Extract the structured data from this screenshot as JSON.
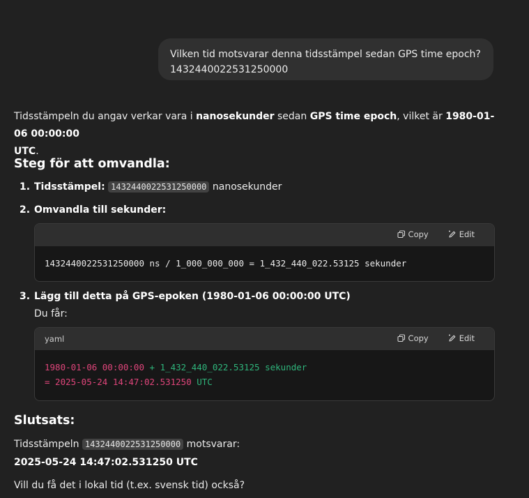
{
  "user_message": {
    "line1": "Vilken tid motsvarar denna tidsstämpel sedan GPS time epoch?",
    "line2": "1432440022531250000"
  },
  "intro": {
    "t1": "Tidsstämpeln du angav verkar vara i ",
    "b1": "nanosekunder",
    "t2": " sedan ",
    "b2": "GPS time epoch",
    "t3": ", vilket är ",
    "b3": "1980-01-06 00:00:00",
    "b4": "UTC",
    "t4": "."
  },
  "steps_heading": "Steg för att omvandla:",
  "steps": [
    {
      "num": "1.",
      "label": "Tidsstämpel:",
      "code": "1432440022531250000",
      "suffix": " nanosekunder"
    },
    {
      "num": "2.",
      "label": "Omvandla till sekunder:",
      "codeblock": {
        "language": "",
        "copy_label": "Copy",
        "edit_label": "Edit",
        "line": "1432440022531250000 ns / 1_000_000_000 = 1_432_440_022.53125 sekunder"
      }
    },
    {
      "num": "3.",
      "label": "Lägg till detta på GPS-epoken (1980-01-06 00:00:00 UTC)",
      "subtext": "Du får:",
      "codeblock": {
        "language": "yaml",
        "copy_label": "Copy",
        "edit_label": "Edit",
        "line1_a": "1980-01-06 00:00:00",
        "line1_b": " + 1_432_440_022.53125 sekunder",
        "line2_a": "= 2025-05-24 14:47:02.531250",
        "line2_b": " UTC"
      }
    }
  ],
  "conclusion_heading": "Slutsats:",
  "conclusion": {
    "t1": "Tidsstämpeln ",
    "code": "1432440022531250000",
    "t2": " motsvarar:",
    "result": "2025-05-24 14:47:02.531250 UTC"
  },
  "followup": "Vill du få det i lokal tid (t.ex. svensk tid) också?",
  "icons": {
    "copy": "copy-icon",
    "edit": "edit-icon"
  },
  "colors": {
    "background": "#212121",
    "user_bubble": "#303030",
    "code_bg": "#171717",
    "code_header": "#2f2f2f",
    "token_red": "#e0457b",
    "token_green": "#2fb67c"
  }
}
